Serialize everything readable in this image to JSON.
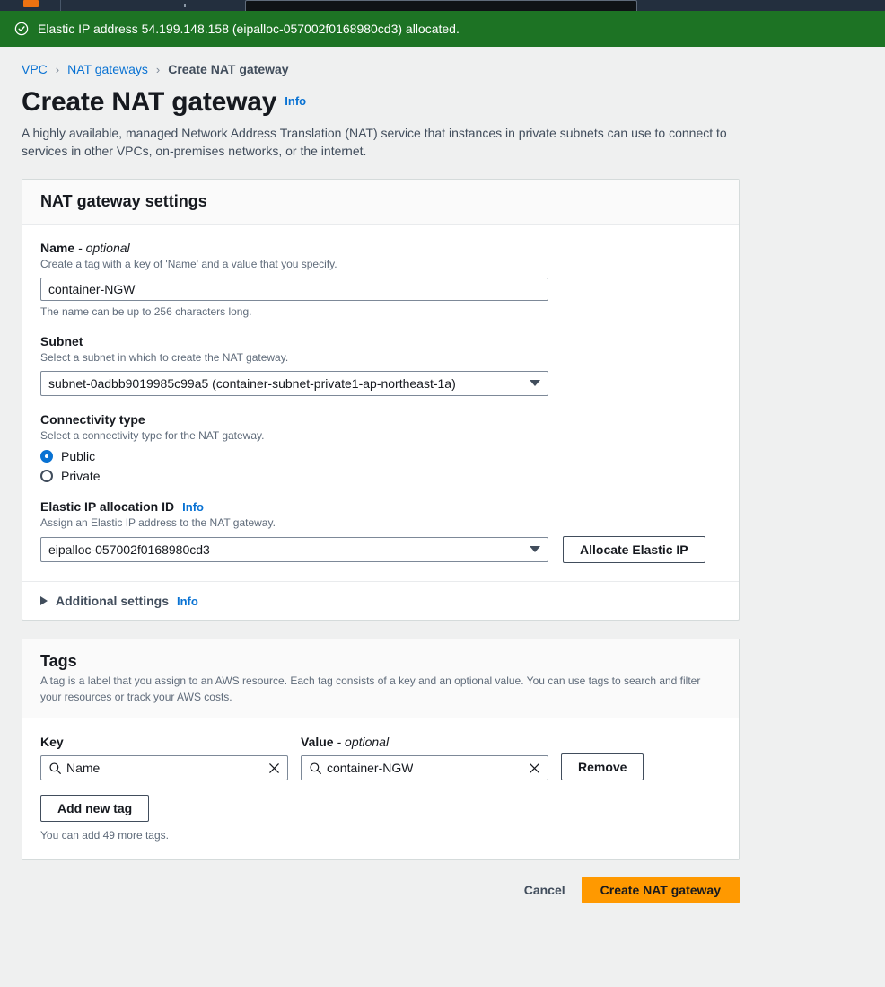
{
  "console": {
    "logo_icon": "aws-logo-icon",
    "search_placeholder": ""
  },
  "flash": {
    "icon": "success-check-circle-icon",
    "message": "Elastic IP address 54.199.148.158 (eipalloc-057002f0168980cd3) allocated.",
    "background_color": "#1d7324"
  },
  "breadcrumb": {
    "items": [
      {
        "label": "VPC",
        "current": false
      },
      {
        "label": "NAT gateways",
        "current": false
      },
      {
        "label": "Create NAT gateway",
        "current": true
      }
    ],
    "separator": "›"
  },
  "header": {
    "title": "Create NAT gateway",
    "info_label": "Info",
    "description": "A highly available, managed Network Address Translation (NAT) service that instances in private subnets can use to connect to services in other VPCs, on-premises networks, or the internet."
  },
  "settings_panel": {
    "title": "NAT gateway settings",
    "name_field": {
      "label": "Name",
      "optional_suffix": "- optional",
      "description": "Create a tag with a key of 'Name' and a value that you specify.",
      "value": "container-NGW",
      "placeholder": "",
      "hint": "The name can be up to 256 characters long."
    },
    "subnet_field": {
      "label": "Subnet",
      "description": "Select a subnet in which to create the NAT gateway.",
      "selected": "subnet-0adbb9019985c99a5 (container-subnet-private1-ap-northeast-1a)"
    },
    "connectivity_field": {
      "label": "Connectivity type",
      "description": "Select a connectivity type for the NAT gateway.",
      "options": [
        {
          "label": "Public",
          "selected": true
        },
        {
          "label": "Private",
          "selected": false
        }
      ]
    },
    "eip_field": {
      "label": "Elastic IP allocation ID",
      "info_label": "Info",
      "description": "Assign an Elastic IP address to the NAT gateway.",
      "selected": "eipalloc-057002f0168980cd3",
      "allocate_button": "Allocate Elastic IP"
    },
    "additional_settings": {
      "label": "Additional settings",
      "info_label": "Info",
      "expanded": false
    }
  },
  "tags_panel": {
    "title": "Tags",
    "description": "A tag is a label that you assign to an AWS resource. Each tag consists of a key and an optional value. You can use tags to search and filter your resources or track your AWS costs.",
    "key_header": "Key",
    "value_header": "Value",
    "value_optional_suffix": "- optional",
    "rows": [
      {
        "key": "Name",
        "value": "container-NGW",
        "remove_label": "Remove"
      }
    ],
    "add_button": "Add new tag",
    "hint": "You can add 49 more tags."
  },
  "footer": {
    "cancel_label": "Cancel",
    "submit_label": "Create NAT gateway",
    "submit_color": "#ff9900"
  }
}
